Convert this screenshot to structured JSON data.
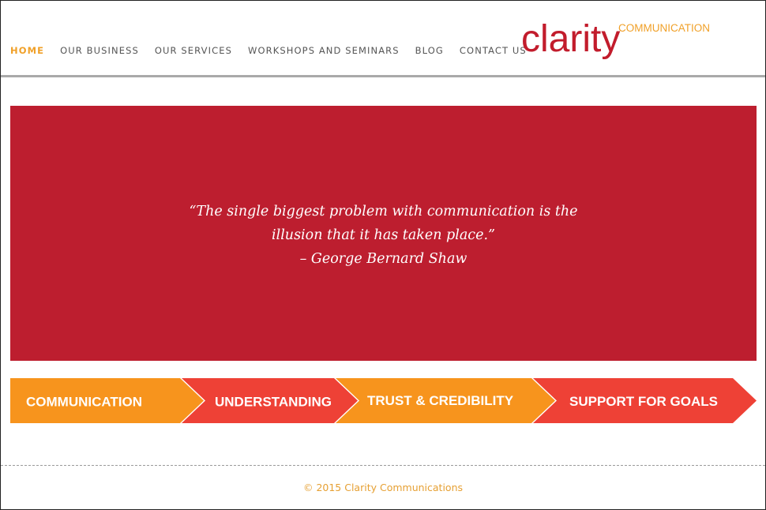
{
  "nav": {
    "items": [
      {
        "label": "HOME",
        "active": true
      },
      {
        "label": "OUR BUSINESS",
        "active": false
      },
      {
        "label": "OUR SERVICES",
        "active": false
      },
      {
        "label": "WORKSHOPS AND SEMINARS",
        "active": false
      },
      {
        "label": "BLOG",
        "active": false
      },
      {
        "label": "CONTACT US",
        "active": false
      }
    ]
  },
  "logo": {
    "main": "clarity",
    "sub": "COMMUNICATION",
    "main_color": "#c21c2c",
    "sub_color": "#f0a028"
  },
  "hero": {
    "background": "#bd1e2f",
    "quote_line1": "“The single biggest problem with communication is the",
    "quote_line2": "illusion that it has taken place.”",
    "attribution": "– George Bernard Shaw"
  },
  "process": {
    "steps": [
      {
        "label": "COMMUNICATION",
        "color": "#f7941d"
      },
      {
        "label": "UNDERSTANDING",
        "color": "#ee4136"
      },
      {
        "label": "TRUST & CREDIBILITY",
        "color": "#f7941d"
      },
      {
        "label": "SUPPORT FOR GOALS",
        "color": "#ee4136"
      }
    ]
  },
  "footer": {
    "copyright": "© 2015 Clarity Communications"
  }
}
